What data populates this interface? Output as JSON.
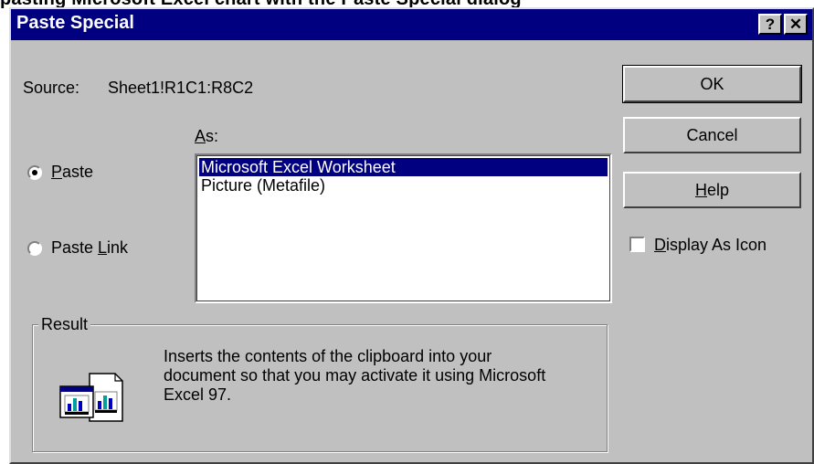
{
  "background_text": "pasting Microsoft Excel chart with the Paste Special dialog",
  "dialog": {
    "title": "Paste Special",
    "help_button": "?",
    "close_button": "✕"
  },
  "source": {
    "label": "Source:",
    "value": "Sheet1!R1C1:R8C2"
  },
  "as_label": {
    "mnemonic": "A",
    "rest": "s:"
  },
  "radios": {
    "paste": {
      "mnemonic": "P",
      "rest": "aste",
      "selected": true
    },
    "paste_link": {
      "before": "Paste ",
      "mnemonic": "L",
      "rest": "ink",
      "selected": false
    }
  },
  "list": {
    "items": [
      "Microsoft Excel Worksheet",
      "Picture (Metafile)"
    ],
    "selected_index": 0
  },
  "buttons": {
    "ok": "OK",
    "cancel": "Cancel",
    "help": {
      "mnemonic": "H",
      "rest": "elp"
    }
  },
  "display_as_icon": {
    "mnemonic": "D",
    "rest": "isplay As Icon",
    "checked": false
  },
  "result": {
    "legend": "Result",
    "text": "Inserts the contents of the clipboard into your document so that you may activate it using Microsoft Excel 97."
  },
  "colors": {
    "titlebar": "#000080",
    "dialog_face": "#c0c0c0",
    "selection": "#000080"
  }
}
